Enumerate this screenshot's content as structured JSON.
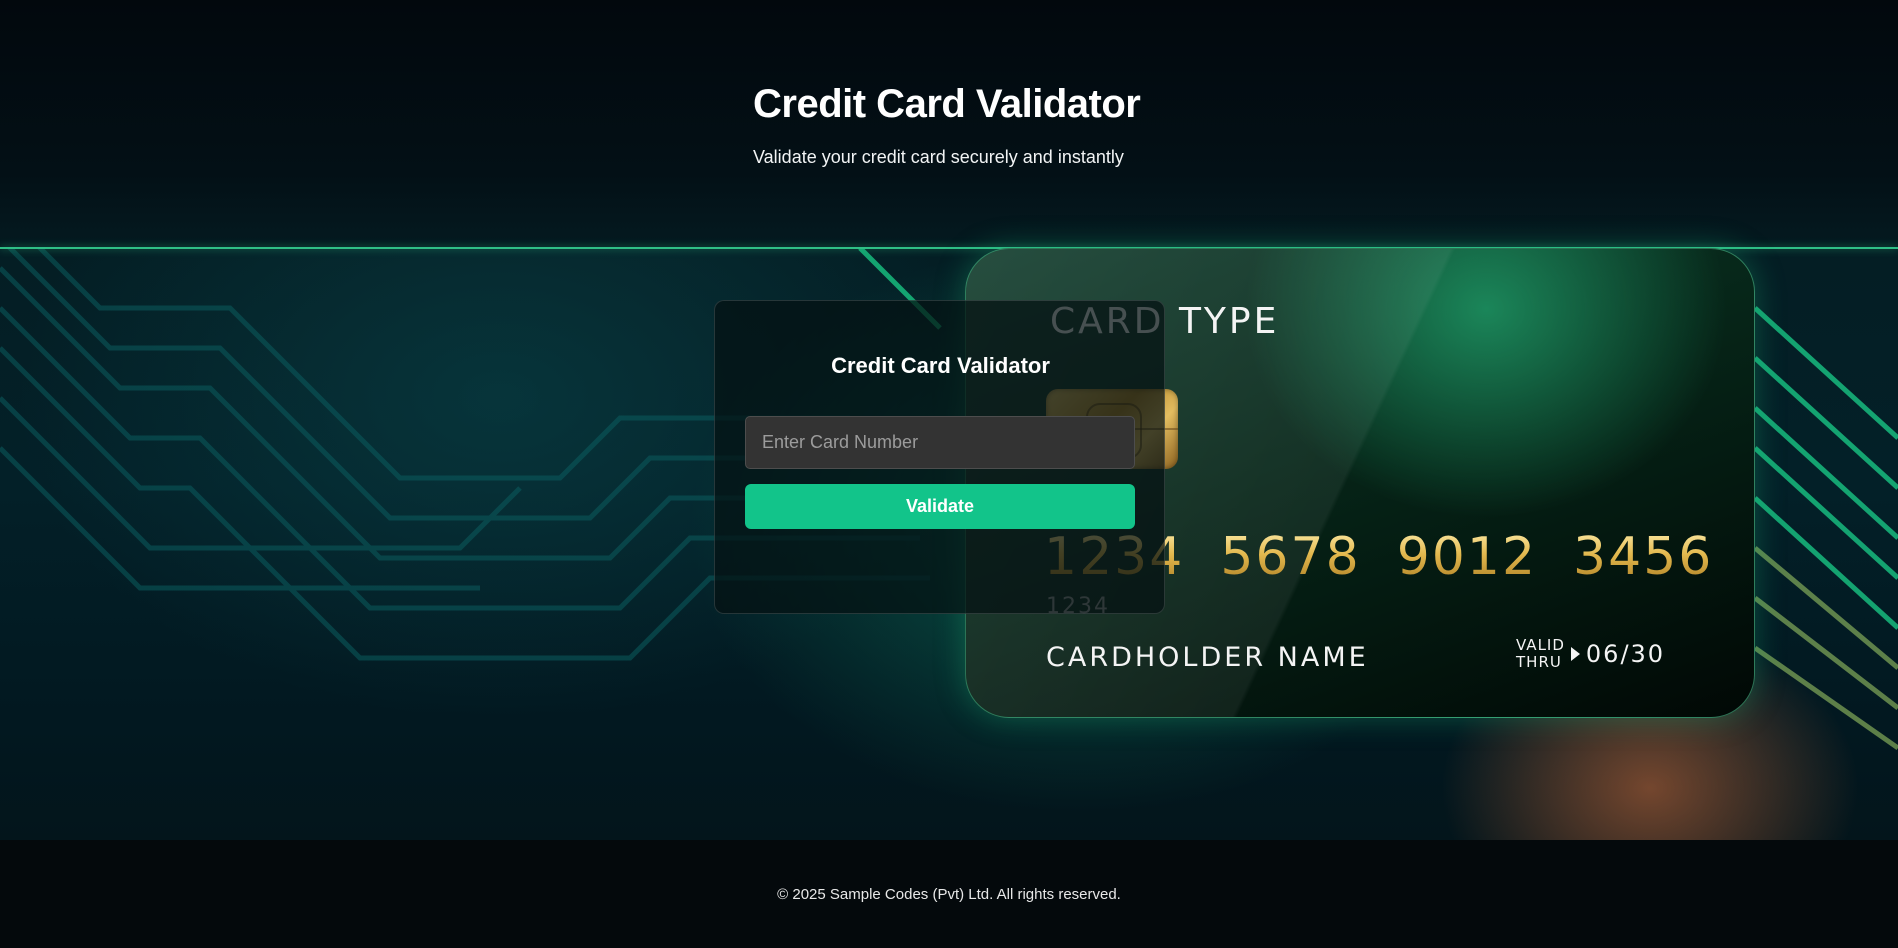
{
  "header": {
    "title": "Credit Card Validator",
    "subtitle": "Validate your credit card securely and instantly"
  },
  "card_preview": {
    "type_label": "CARD TYPE",
    "number_groups": [
      "1234",
      "5678",
      "9012",
      "3456"
    ],
    "number_small": "1234",
    "holder_name": "CARDHOLDER NAME",
    "valid_label_line1": "VALID",
    "valid_label_line2": "THRU",
    "expiry": "06/30"
  },
  "validator": {
    "title": "Credit Card Validator",
    "input_placeholder": "Enter Card Number",
    "input_value": "",
    "button_label": "Validate"
  },
  "footer": {
    "copyright": "© 2025 Sample Codes (Pvt) Ltd. All rights reserved."
  },
  "colors": {
    "accent": "#12c48a",
    "divider": "#2fbf86",
    "background": "#020a10"
  }
}
